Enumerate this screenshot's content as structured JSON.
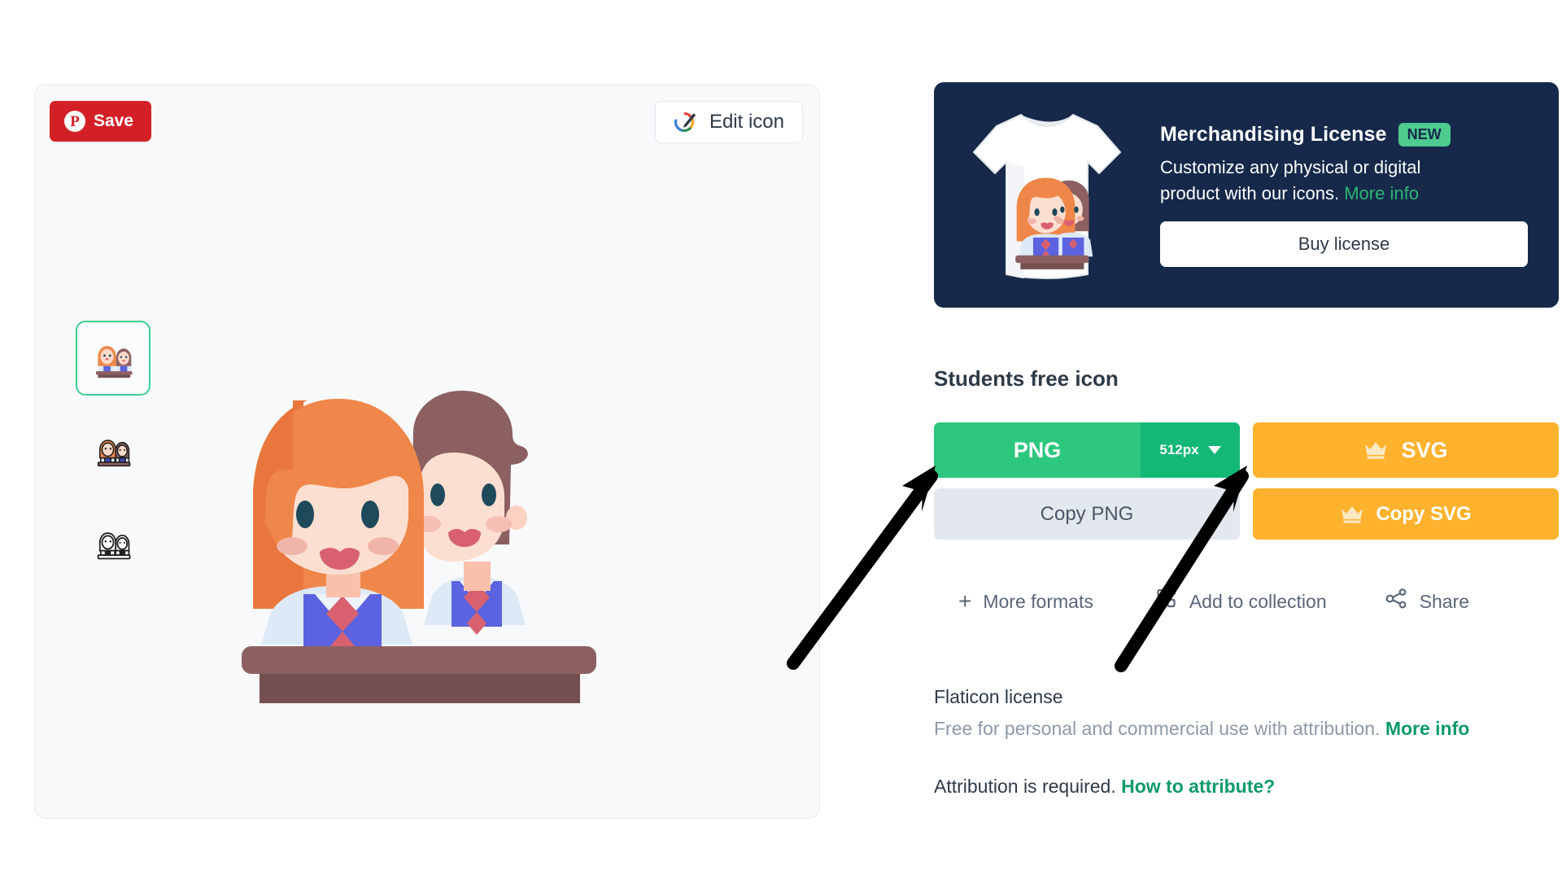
{
  "preview": {
    "save_label": "Save",
    "save_icon": "pinterest-icon",
    "edit_label": "Edit icon",
    "edit_icon": "edit-pencil-icon",
    "thumbnails": [
      {
        "name": "students-flat-color",
        "style": "flat-color",
        "selected": true
      },
      {
        "name": "students-outline-color",
        "style": "outline-color",
        "selected": false
      },
      {
        "name": "students-lineal",
        "style": "lineal",
        "selected": false
      }
    ],
    "main_icon_name": "students-illustration"
  },
  "merchandising": {
    "title": "Merchandising License",
    "badge": "NEW",
    "description_1": "Customize any physical or digital",
    "description_2": "product with our icons.",
    "more_info_label": "More info",
    "buy_label": "Buy license",
    "tshirt_icon": "tshirt-preview-icon",
    "bg_color": "#16294a",
    "badge_color": "#4ecb8e",
    "link_color": "#2bb673"
  },
  "downloads": {
    "heading": "Students free icon",
    "png_label": "PNG",
    "png_size": "512px",
    "png_caret_icon": "chevron-down-icon",
    "svg_label": "SVG",
    "svg_crown_icon": "crown-icon",
    "copy_png_label": "Copy PNG",
    "copy_svg_label": "Copy SVG",
    "copy_svg_crown_icon": "crown-icon",
    "png_color": "#2ec77f",
    "png_size_color": "#13b877",
    "svg_color": "#ffb22e",
    "copy_png_color": "#e2e8ed"
  },
  "actions": [
    {
      "label": "More formats",
      "icon": "plus-icon"
    },
    {
      "label": "Add to collection",
      "icon": "add-to-collection-icon"
    },
    {
      "label": "Share",
      "icon": "share-icon"
    }
  ],
  "license": {
    "title": "Flaticon license",
    "description": "Free for personal and commercial use with attribution.",
    "more_info_label": "More info",
    "attribution_text": "Attribution is required.",
    "attribution_link": "How to attribute?",
    "link_color": "#0f9a68"
  },
  "annotations": {
    "arrow_1_target": "png-download-button",
    "arrow_2_target": "svg-download-button",
    "arrow_color": "#000000"
  }
}
